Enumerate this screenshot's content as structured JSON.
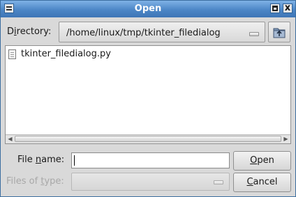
{
  "window": {
    "title": "Open",
    "close_glyph": "x"
  },
  "directory": {
    "label_before": "D",
    "label_underlined": "i",
    "label_after": "rectory:",
    "path": "/home/linux/tmp/tkinter_filedialog",
    "up_button_icon": "folder-up-icon"
  },
  "files": [
    {
      "name": "tkinter_filedialog.py",
      "icon": "file-icon"
    }
  ],
  "filename": {
    "label_before": "File ",
    "label_underlined": "n",
    "label_after": "ame:",
    "value": ""
  },
  "filetype": {
    "label_before": "Files of ",
    "label_underlined": "t",
    "label_after": "ype:",
    "value": ""
  },
  "buttons": {
    "open": {
      "underlined": "O",
      "rest": "pen"
    },
    "cancel": {
      "underlined": "C",
      "rest": "ancel"
    }
  },
  "colors": {
    "titlebar": "#4c86c6",
    "title_text": "#ffffff",
    "disabled_text": "#a8a8a8"
  }
}
